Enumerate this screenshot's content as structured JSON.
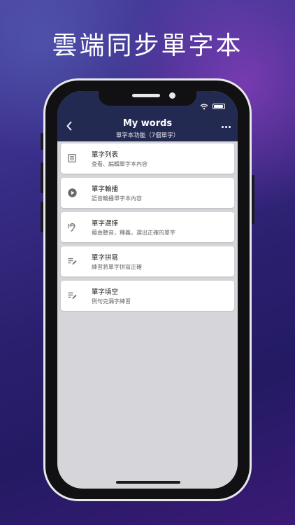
{
  "headline": "雲端同步單字本",
  "appbar": {
    "title": "My words",
    "subtitle": "單字本功能（7個單字）",
    "back_icon": "chevron-left-icon",
    "more_icon": "more-horizontal-icon"
  },
  "status_bar": {
    "wifi_icon": "wifi-icon",
    "battery_icon": "battery-icon"
  },
  "menu": [
    {
      "title": "單字列表",
      "subtitle": "查看、編輯單字本內容",
      "icon": "list-icon"
    },
    {
      "title": "單字輪播",
      "subtitle": "語音輪播單字本內容",
      "icon": "play-circle-icon"
    },
    {
      "title": "單字選擇",
      "subtitle": "藉由聽音，釋義，選出正確的單字",
      "icon": "ear-icon"
    },
    {
      "title": "單字拼寫",
      "subtitle": "練習將單字拼寫正確",
      "icon": "edit-lines-icon"
    },
    {
      "title": "單字填空",
      "subtitle": "例句克漏字練習",
      "icon": "edit-lines-icon"
    }
  ],
  "colors": {
    "appbar": "#232a52",
    "screen_bg": "#d6d6da",
    "card_bg": "#ffffff",
    "icon": "#6b6b6b"
  }
}
